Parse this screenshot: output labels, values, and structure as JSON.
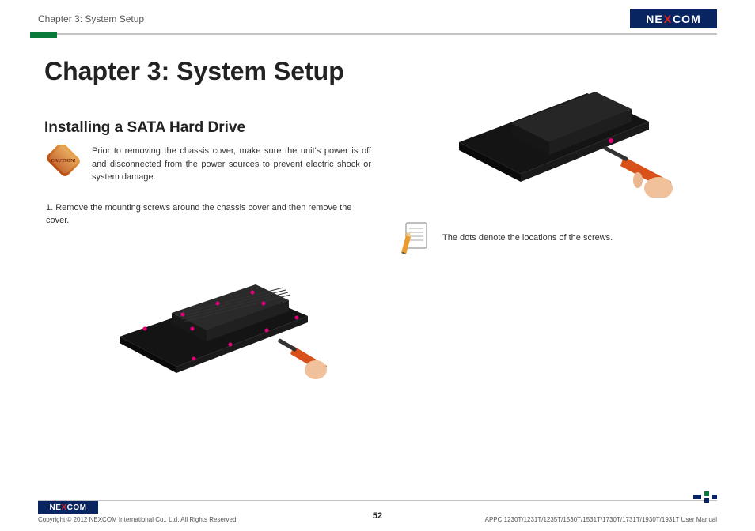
{
  "header": {
    "breadcrumb": "Chapter 3: System Setup",
    "logo_text_1": "NE",
    "logo_text_x": "X",
    "logo_text_2": "COM"
  },
  "content": {
    "chapter_title": "Chapter 3: System Setup",
    "section_title": "Installing a SATA Hard Drive",
    "caution_label": "CAUTION!",
    "caution_text": "Prior to removing the chassis cover, make sure the unit's power is off and disconnected from the power sources to prevent electric shock or system damage.",
    "step1": "1. Remove the mounting screws around the chassis cover and then remove the cover.",
    "note_text": "The dots denote the locations of the screws."
  },
  "footer": {
    "logo_text_1": "NE",
    "logo_text_x": "X",
    "logo_text_2": "COM",
    "copyright": "Copyright © 2012 NEXCOM International Co., Ltd. All Rights Reserved.",
    "page": "52",
    "manual": "APPC 1230T/1231T/1235T/1530T/1531T/1730T/1731T/1930T/1931T User Manual"
  }
}
